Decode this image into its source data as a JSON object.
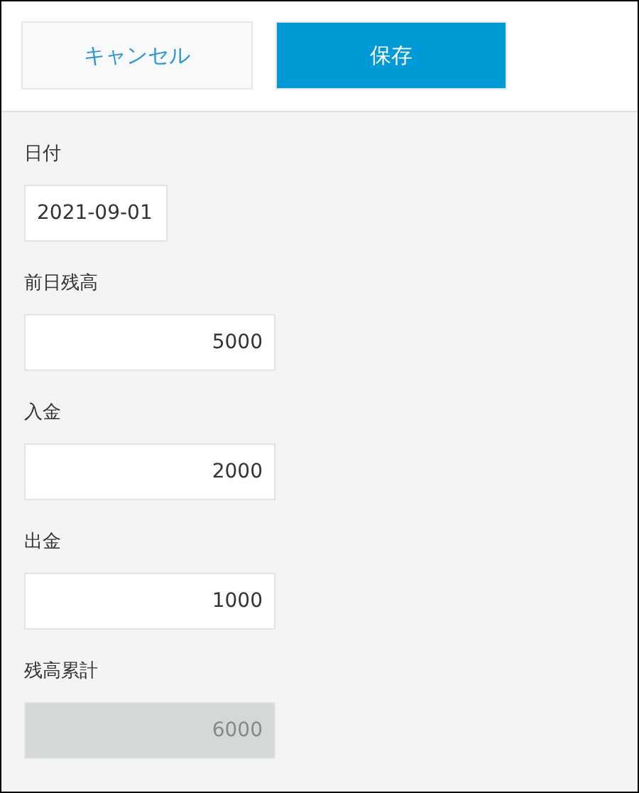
{
  "toolbar": {
    "buttons": [
      {
        "kind": "cancel",
        "label": "キャンセル"
      },
      {
        "kind": "save",
        "label": "保存"
      }
    ]
  },
  "fields": [
    {
      "label": "日付",
      "kind": "date",
      "value": "2021-09-01",
      "disabled": false
    },
    {
      "label": "前日残高",
      "kind": "number",
      "value": "5000",
      "disabled": false
    },
    {
      "label": "入金",
      "kind": "number",
      "value": "2000",
      "disabled": false
    },
    {
      "label": "出金",
      "kind": "number",
      "value": "1000",
      "disabled": false
    },
    {
      "label": "残高累計",
      "kind": "number",
      "value": "6000",
      "disabled": true
    }
  ]
}
